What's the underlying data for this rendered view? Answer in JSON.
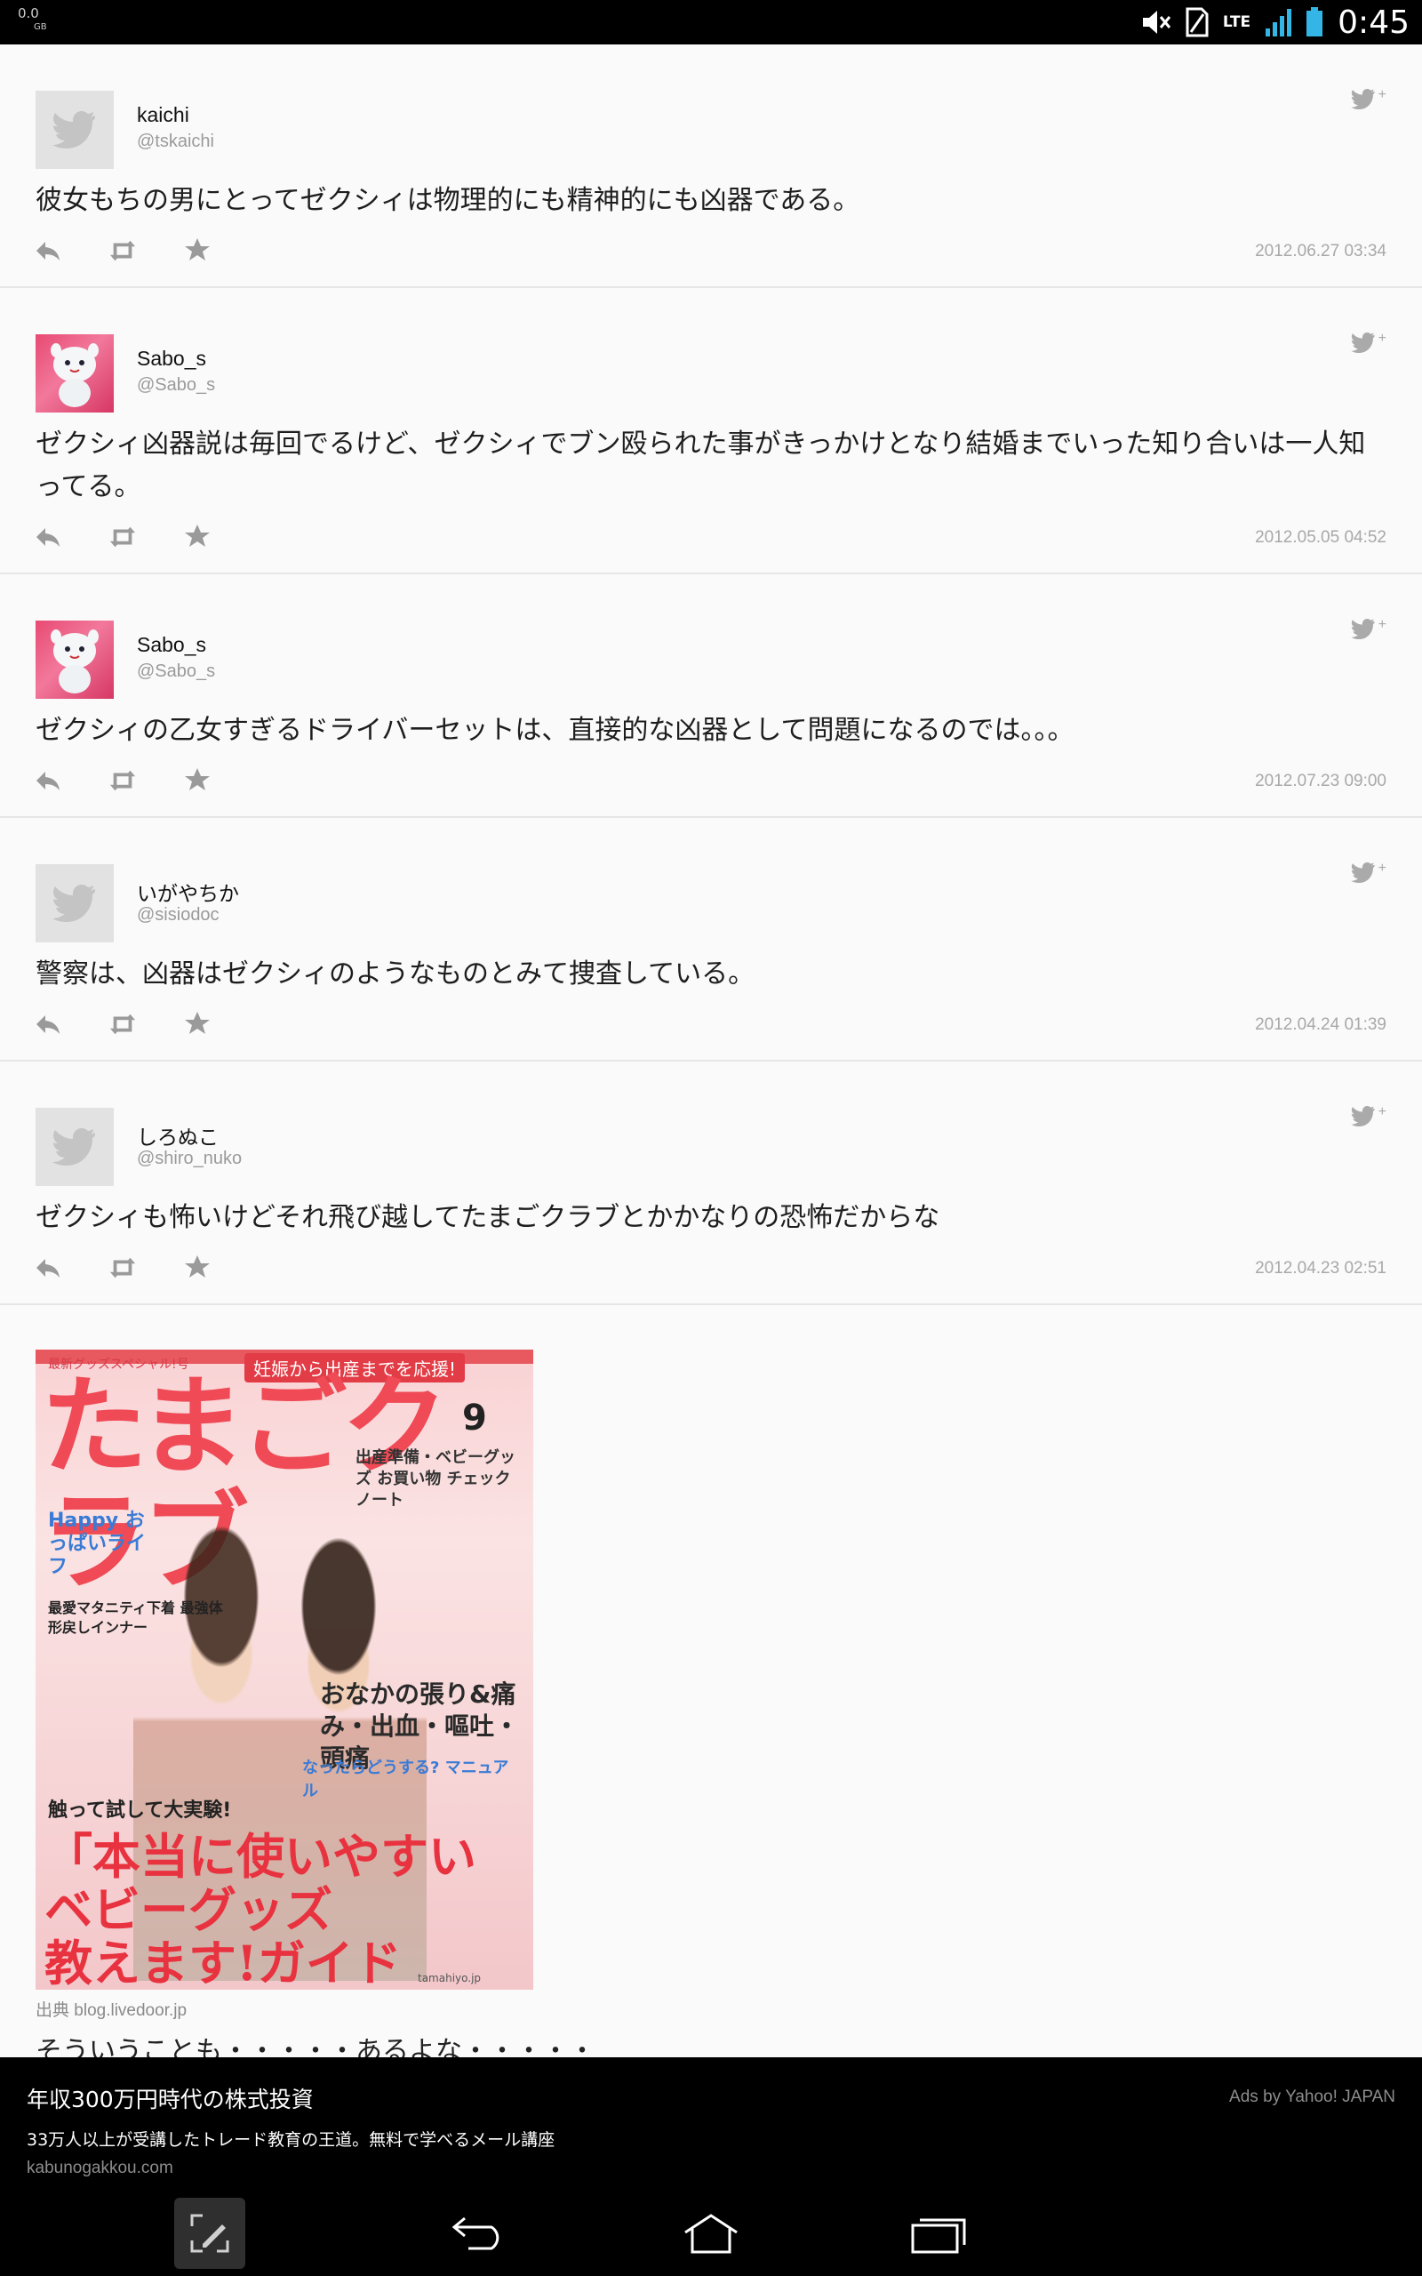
{
  "status_bar": {
    "data_speed": "0.0",
    "data_unit": "GB",
    "network": "LTE",
    "time": "0:45",
    "icons": [
      "mute-icon",
      "sim-icon",
      "lte-icon",
      "signal-icon",
      "battery-icon"
    ]
  },
  "tweets": [
    {
      "name": "kaichi",
      "handle": "@tskaichi",
      "avatar": "default-avatar-icon",
      "text": "彼女もちの男にとってゼクシィは物理的にも精神的にも凶器である。",
      "date": "2012.06.27 03:34"
    },
    {
      "name": "Sabo_s",
      "handle": "@Sabo_s",
      "avatar": "photo-avatar",
      "text": "ゼクシィ凶器説は毎回でるけど、ゼクシィでブン殴られた事がきっかけとなり結婚までいった知り合いは一人知ってる。",
      "date": "2012.05.05 04:52"
    },
    {
      "name": "Sabo_s",
      "handle": "@Sabo_s",
      "avatar": "photo-avatar",
      "text": "ゼクシィの乙女すぎるドライバーセットは、直接的な凶器として問題になるのでは。。。",
      "date": "2012.07.23 09:00"
    },
    {
      "name": "いがやちか",
      "handle": "@sisiodoc",
      "avatar": "default-avatar-icon",
      "text": "警察は、凶器はゼクシィのようなものとみて捜査している。",
      "date": "2012.04.24 01:39"
    },
    {
      "name": "しろぬこ",
      "handle": "@shiro_nuko",
      "avatar": "default-avatar-icon",
      "text": "ゼクシィも怖いけどそれ飛び越してたまごクラブとかかなりの恐怖だからな",
      "date": "2012.04.23 02:51"
    }
  ],
  "image": {
    "series": "最新グッズスペシャル!号",
    "banner": "妊娠から出産までを応援!",
    "title": "たまごクラブ",
    "issue": "9",
    "blurb_1": "出産準備・ベビーグッズ お買い物 チェックノート",
    "blurb_2": "Happy おっぱいライフ",
    "blurb_3": "最愛マタニティ下着 最強体形戻しインナー",
    "blurb_4": "おなかの張り&痛み・出血・嘔吐・頭痛",
    "blurb_5": "なったらどうする? マニュアル",
    "blurb_6": "触って試して大実験!",
    "bottom_text_1": "「本当に使いやすい",
    "bottom_text_2": "ベビーグッズ",
    "bottom_text_3": "教えます!ガイド",
    "site": "tamahiyo.jp"
  },
  "source": "出典 blog.livedoor.jp",
  "partial_text": "そういうことも・・・・・あるよな・・・・・",
  "ad": {
    "title": "年収300万円時代の株式投資",
    "description": "33万人以上が受講したトレード教育の王道。無料で学べるメール講座",
    "url": "kabunogakkou.com",
    "provider": "Ads by Yahoo! JAPAN"
  },
  "nav": [
    "compose-icon",
    "back-icon",
    "home-icon",
    "recent-apps-icon"
  ]
}
